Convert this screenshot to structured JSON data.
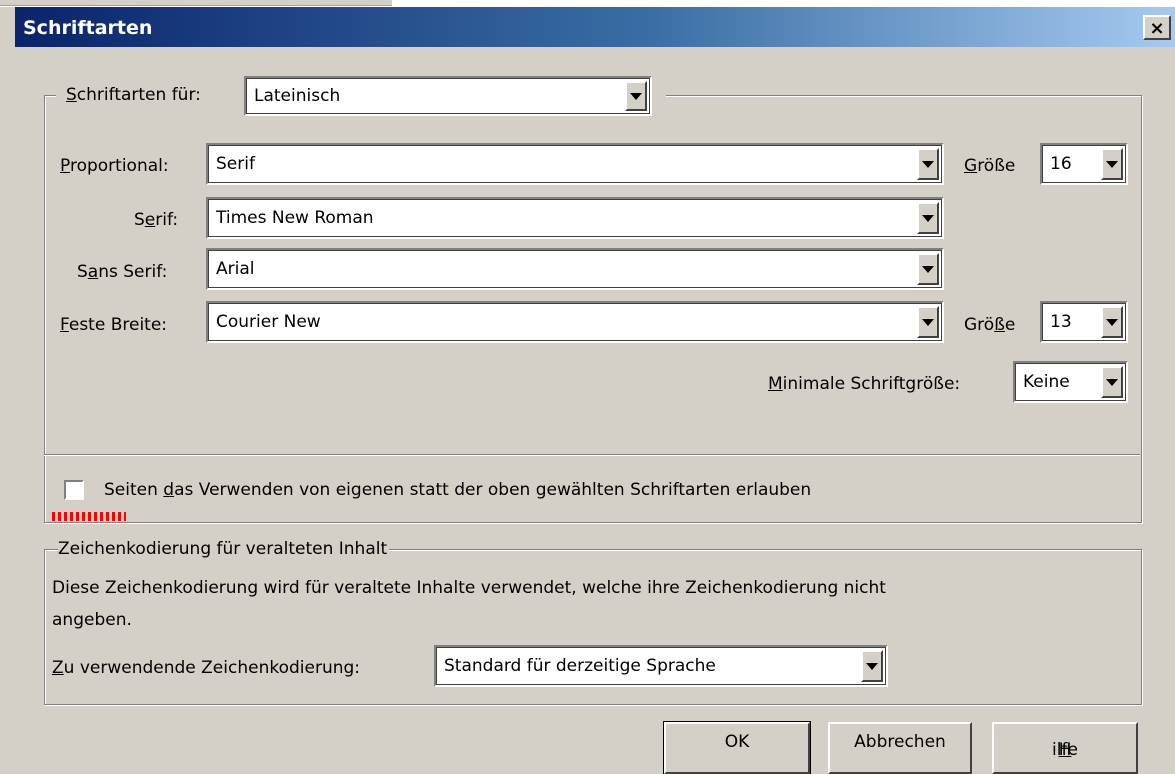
{
  "window": {
    "title": "Schriftarten",
    "close_label": "×"
  },
  "fonts_group": {
    "for_label_pre": "",
    "for_label_u": "S",
    "for_label_post": "chriftarten für:",
    "language_value": "Lateinisch",
    "proportional": {
      "label_u": "P",
      "label_post": "roportional:",
      "value": "Serif"
    },
    "size1": {
      "label_u": "G",
      "label_post": "röße",
      "value": "16"
    },
    "serif": {
      "label_pre": "S",
      "label_u": "e",
      "label_post": "rif:",
      "value": "Times New Roman"
    },
    "sans_serif": {
      "label_pre": "S",
      "label_u": "a",
      "label_post": "ns Serif:",
      "value": "Arial"
    },
    "monospace": {
      "label_u": "F",
      "label_post": "este Breite:",
      "value": "Courier New"
    },
    "size2": {
      "label_pre": "Grö",
      "label_u": "ß",
      "label_post": "e",
      "value": "13"
    },
    "min_size": {
      "label_u": "M",
      "label_post": "inimale Schriftgröße:",
      "value": "Keine"
    },
    "allow_pages_checkbox": {
      "checked": false,
      "label_pre": "Seiten ",
      "label_u": "d",
      "label_post": "as Verwenden von eigenen statt der oben gewählten Schriftarten erlauben"
    }
  },
  "encoding_group": {
    "title": "Zeichenkodierung für veralteten Inhalt",
    "description_line1": "Diese Zeichenkodierung wird für veraltete Inhalte verwendet, welche ihre Zeichenkodierung nicht",
    "description_line2": "angeben.",
    "label_u": "Z",
    "label_post": "u verwendende Zeichenkodierung:",
    "value": "Standard für derzeitige Sprache"
  },
  "buttons": {
    "ok": "OK",
    "cancel": "Abbrechen",
    "help_u": "H",
    "help_post": "ilfe"
  },
  "colors": {
    "dialog_bg": "#d4d0c8",
    "titlebar_start": "#0a246a",
    "titlebar_end": "#a6caf0",
    "mark_red": "#ff0000"
  }
}
